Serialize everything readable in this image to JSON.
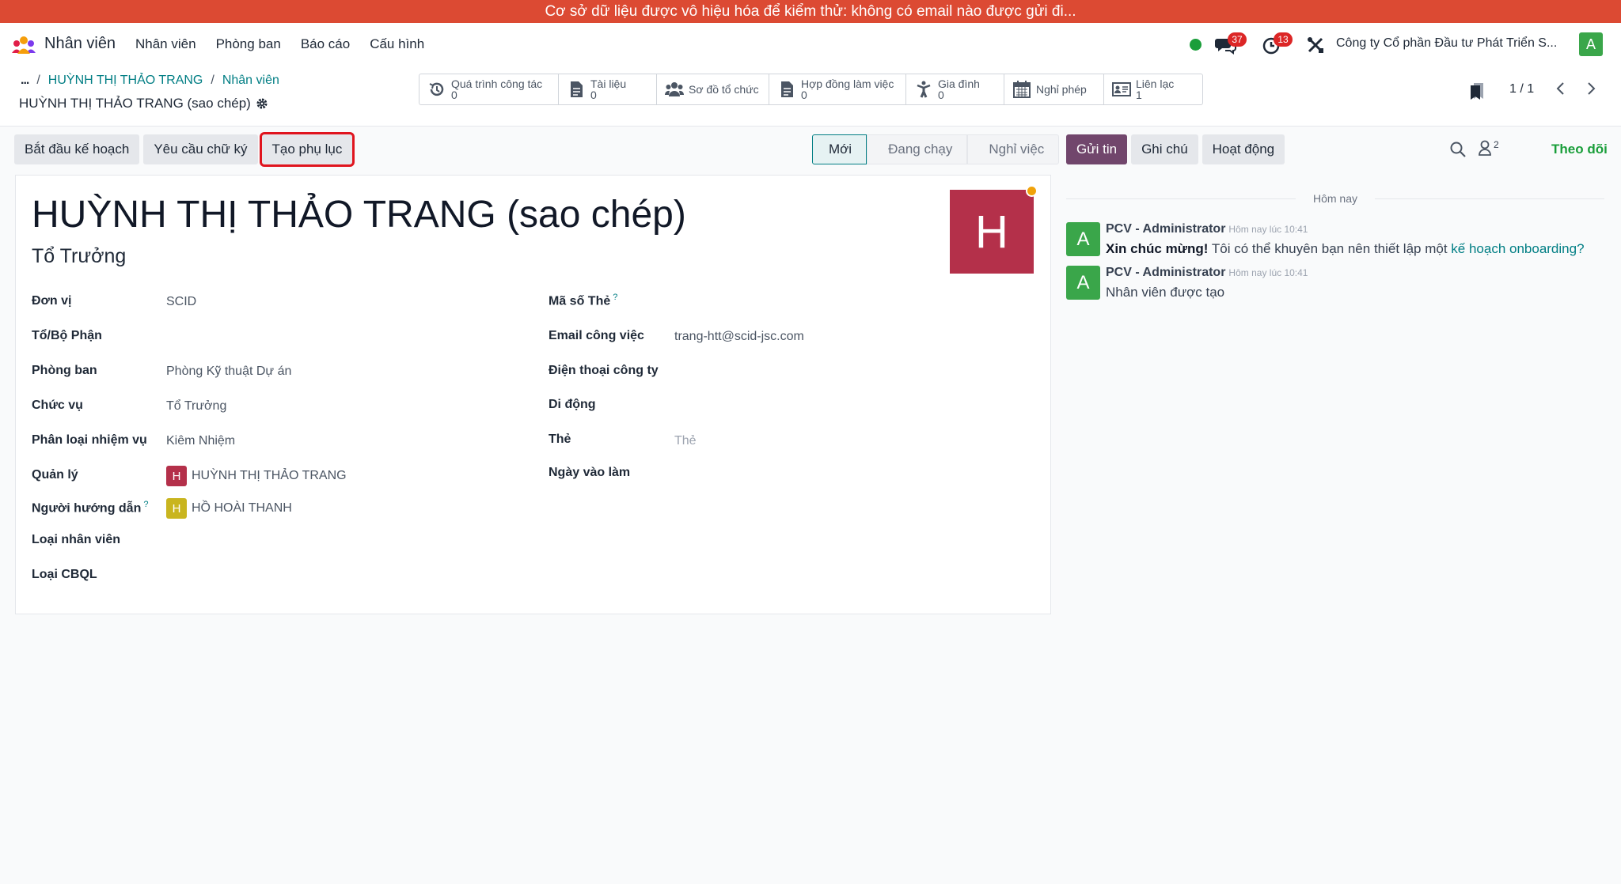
{
  "banner": {
    "text": "Cơ sở dữ liệu được vô hiệu hóa để kiểm thử: không có email nào được gửi đi..."
  },
  "navbar": {
    "app_name": "Nhân viên",
    "menu": [
      "Nhân viên",
      "Phòng ban",
      "Báo cáo",
      "Cấu hình"
    ],
    "messages_count": "37",
    "activities_count": "13",
    "company": "Công ty Cổ phần Đầu tư Phát Triển S...",
    "user_initial": "A"
  },
  "control_panel": {
    "breadcrumb": {
      "dots": "...",
      "items": [
        "HUỲNH THỊ THẢO TRANG",
        "Nhân viên"
      ]
    },
    "record_title": "HUỲNH THỊ THẢO TRANG (sao chép)",
    "smart_buttons": [
      {
        "label": "Quá trình công tác",
        "count": "0"
      },
      {
        "label": "Tài liệu",
        "count": "0"
      },
      {
        "label": "Sơ đồ tổ chức"
      },
      {
        "label": "Hợp đồng làm việc",
        "count": "0"
      },
      {
        "label": "Gia đình",
        "count": "0"
      },
      {
        "label": "Nghỉ phép"
      },
      {
        "label": "Liên lạc",
        "count": "1"
      }
    ],
    "pager": "1 / 1"
  },
  "actions": {
    "start_plan": "Bắt đầu kế hoạch",
    "request_signature": "Yêu cầu chữ ký",
    "create_appendix": "Tạo phụ lục"
  },
  "status_bar": {
    "stages": [
      "Mới",
      "Đang chạy",
      "Nghỉ việc"
    ],
    "active": "Mới"
  },
  "employee": {
    "name": "HUỲNH THỊ THẢO TRANG (sao chép)",
    "job_title": "Tổ Trưởng",
    "avatar_initial": "H",
    "status_color": "#f0a20a",
    "left_fields": [
      {
        "label": "Đơn vị",
        "value": "SCID"
      },
      {
        "label": "Tổ/Bộ Phận",
        "value": ""
      },
      {
        "label": "Phòng ban",
        "value": "Phòng Kỹ thuật Dự án"
      },
      {
        "label": "Chức vụ",
        "value": "Tổ Trưởng"
      },
      {
        "label": "Phân loại nhiệm vụ",
        "value": "Kiêm Nhiệm"
      },
      {
        "label": "Quản lý",
        "value": "HUỲNH THỊ THẢO TRANG",
        "avatar": "H",
        "avatar_color": "#b4304a"
      },
      {
        "label": "Người hướng dẫn",
        "help": "?",
        "value": "HỒ HOÀI THANH",
        "avatar": "H",
        "avatar_color": "#c9b51f"
      },
      {
        "label": "Loại nhân viên",
        "value": ""
      },
      {
        "label": "Loại CBQL",
        "value": ""
      }
    ],
    "right_fields": [
      {
        "label": "Mã số Thẻ",
        "help": "?",
        "value": ""
      },
      {
        "label": "Email công việc",
        "value": "trang-htt@scid-jsc.com"
      },
      {
        "label": "Điện thoại công ty",
        "value": ""
      },
      {
        "label": "Di động",
        "value": ""
      },
      {
        "label": "Thẻ",
        "placeholder": "Thẻ"
      },
      {
        "label": "Ngày vào làm",
        "value": ""
      }
    ]
  },
  "chatter": {
    "send_message": "Gửi tin",
    "log_note": "Ghi chú",
    "activity": "Hoạt động",
    "followers_count": "2",
    "follow": "Theo dõi",
    "date_separator": "Hôm nay",
    "messages": [
      {
        "author": "PCV - Administrator",
        "time": "Hôm nay lúc 10:41",
        "avatar": "A",
        "bold": "Xin chúc mừng!",
        "text": " Tôi có thể khuyên bạn nên thiết lập một ",
        "link": "kế hoạch onboarding?"
      },
      {
        "author": "PCV - Administrator",
        "time": "Hôm nay lúc 10:41",
        "avatar": "A",
        "text": "Nhân viên được tạo"
      }
    ]
  },
  "colors": {
    "banner": "#dc4a33",
    "primary": "#71466c",
    "link": "#017e84",
    "highlight_outline": "#e0141e"
  }
}
